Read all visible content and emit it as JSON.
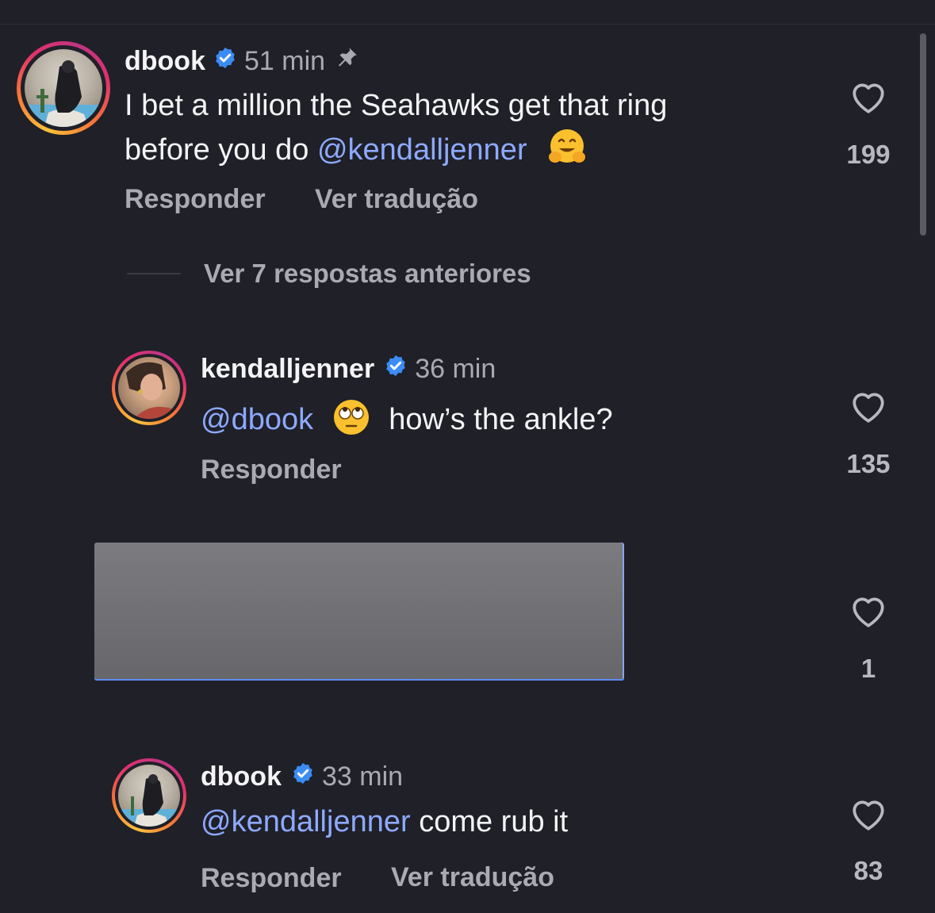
{
  "ui": {
    "background": "#1f2028",
    "text": "#f4f4f6",
    "muted": "#a9aab2",
    "mention": "#8ea9ff",
    "verified": "#3b8cf5"
  },
  "comments": [
    {
      "username": "dbook",
      "time": "51 min",
      "pinned": true,
      "text_line1": "I bet a million the Seahawks get that ring",
      "text_line2_prefix": "before you do ",
      "mention": "@kendalljenner",
      "emoji": "hugging-face-emoji",
      "reply": "Responder",
      "translate": "Ver tradução",
      "likes": "199"
    },
    {
      "username": "kendalljenner",
      "time": "36 min",
      "mention": "@dbook",
      "emoji": "rolling-eyes-emoji",
      "text": "how’s the ankle?",
      "reply": "Responder",
      "likes": "135"
    },
    {
      "redacted": true,
      "likes": "1"
    },
    {
      "username": "dbook",
      "time": "33 min",
      "mention": "@kendalljenner",
      "text": " come rub it",
      "reply": "Responder",
      "translate": "Ver tradução",
      "likes": "83"
    }
  ],
  "view_more": "Ver 7 respostas anteriores",
  "icons": [
    "verified-badge-icon",
    "pin-icon",
    "heart-icon"
  ]
}
